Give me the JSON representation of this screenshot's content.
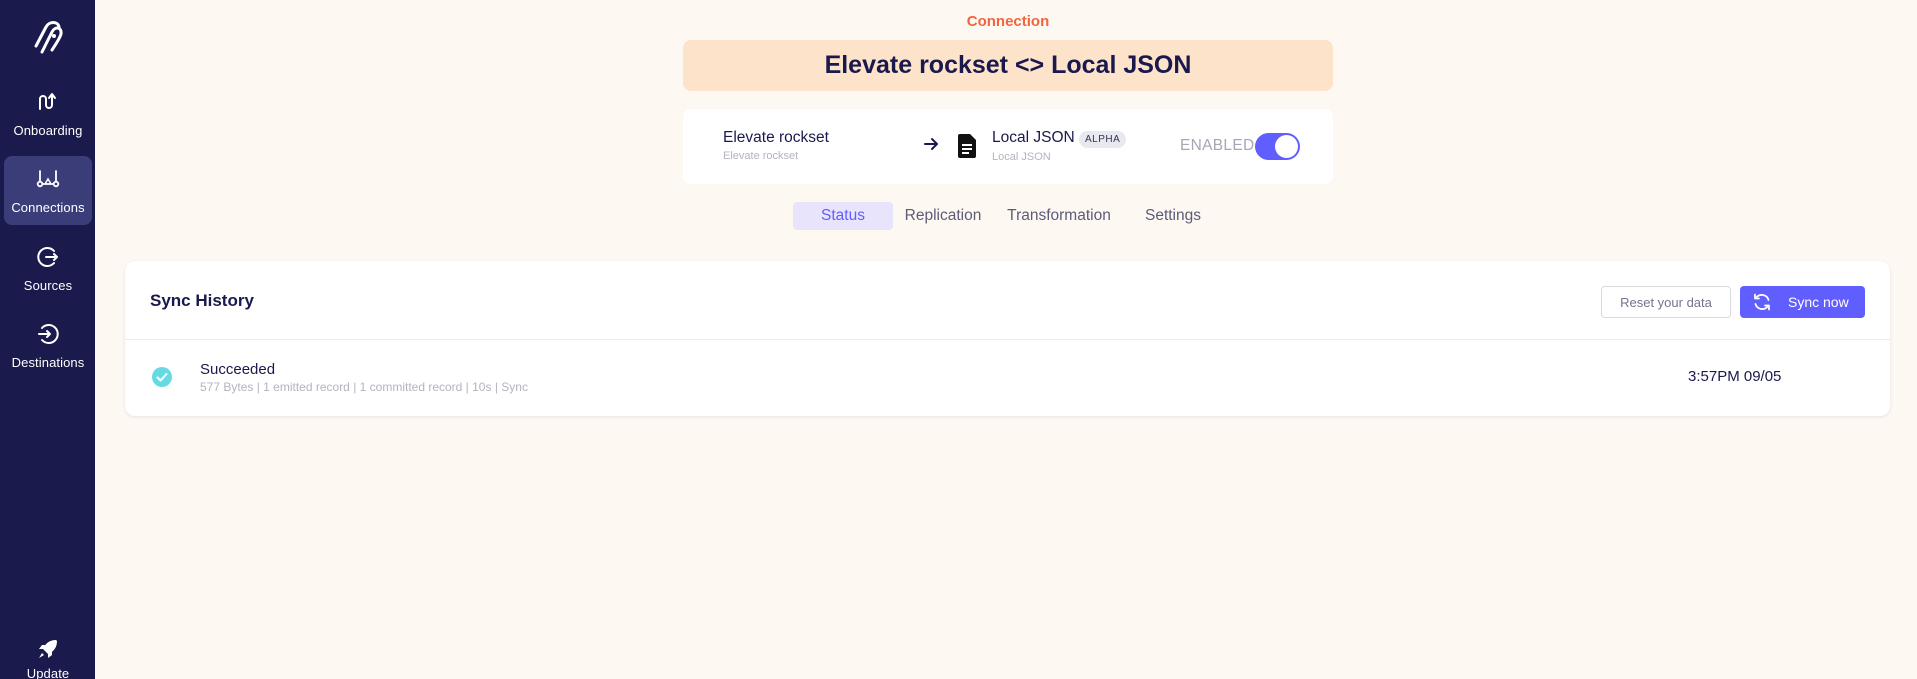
{
  "sidebar": {
    "logo_icon": "airbyte-logo-icon",
    "items": [
      {
        "label": "Onboarding",
        "icon": "onboarding-icon"
      },
      {
        "label": "Connections",
        "icon": "connections-icon",
        "active": true
      },
      {
        "label": "Sources",
        "icon": "sources-icon"
      },
      {
        "label": "Destinations",
        "icon": "destinations-icon"
      }
    ],
    "update": {
      "label": "Update",
      "icon": "rocket-icon"
    }
  },
  "header": {
    "section_label": "Connection",
    "title": "Elevate rockset <> Local JSON"
  },
  "summary": {
    "source_name": "Elevate rockset",
    "source_subtitle": "Elevate rockset",
    "destination_name": "Local JSON",
    "destination_badge": "ALPHA",
    "destination_subtitle": "Local JSON",
    "enabled_label": "ENABLED",
    "enabled": true
  },
  "tabs": [
    {
      "label": "Status",
      "active": true
    },
    {
      "label": "Replication"
    },
    {
      "label": "Transformation"
    },
    {
      "label": "Settings"
    }
  ],
  "sync_history": {
    "title": "Sync History",
    "reset_label": "Reset your data",
    "sync_label": "Sync now",
    "rows": [
      {
        "status": "Succeeded",
        "meta": "577 Bytes | 1 emitted record | 1 committed record | 10s | Sync",
        "time": "3:57PM 09/05"
      }
    ]
  },
  "colors": {
    "sidebar_bg": "#1a1a4c",
    "accent": "#615eff",
    "brand_orange": "#f0643e",
    "success": "#67dae1"
  }
}
